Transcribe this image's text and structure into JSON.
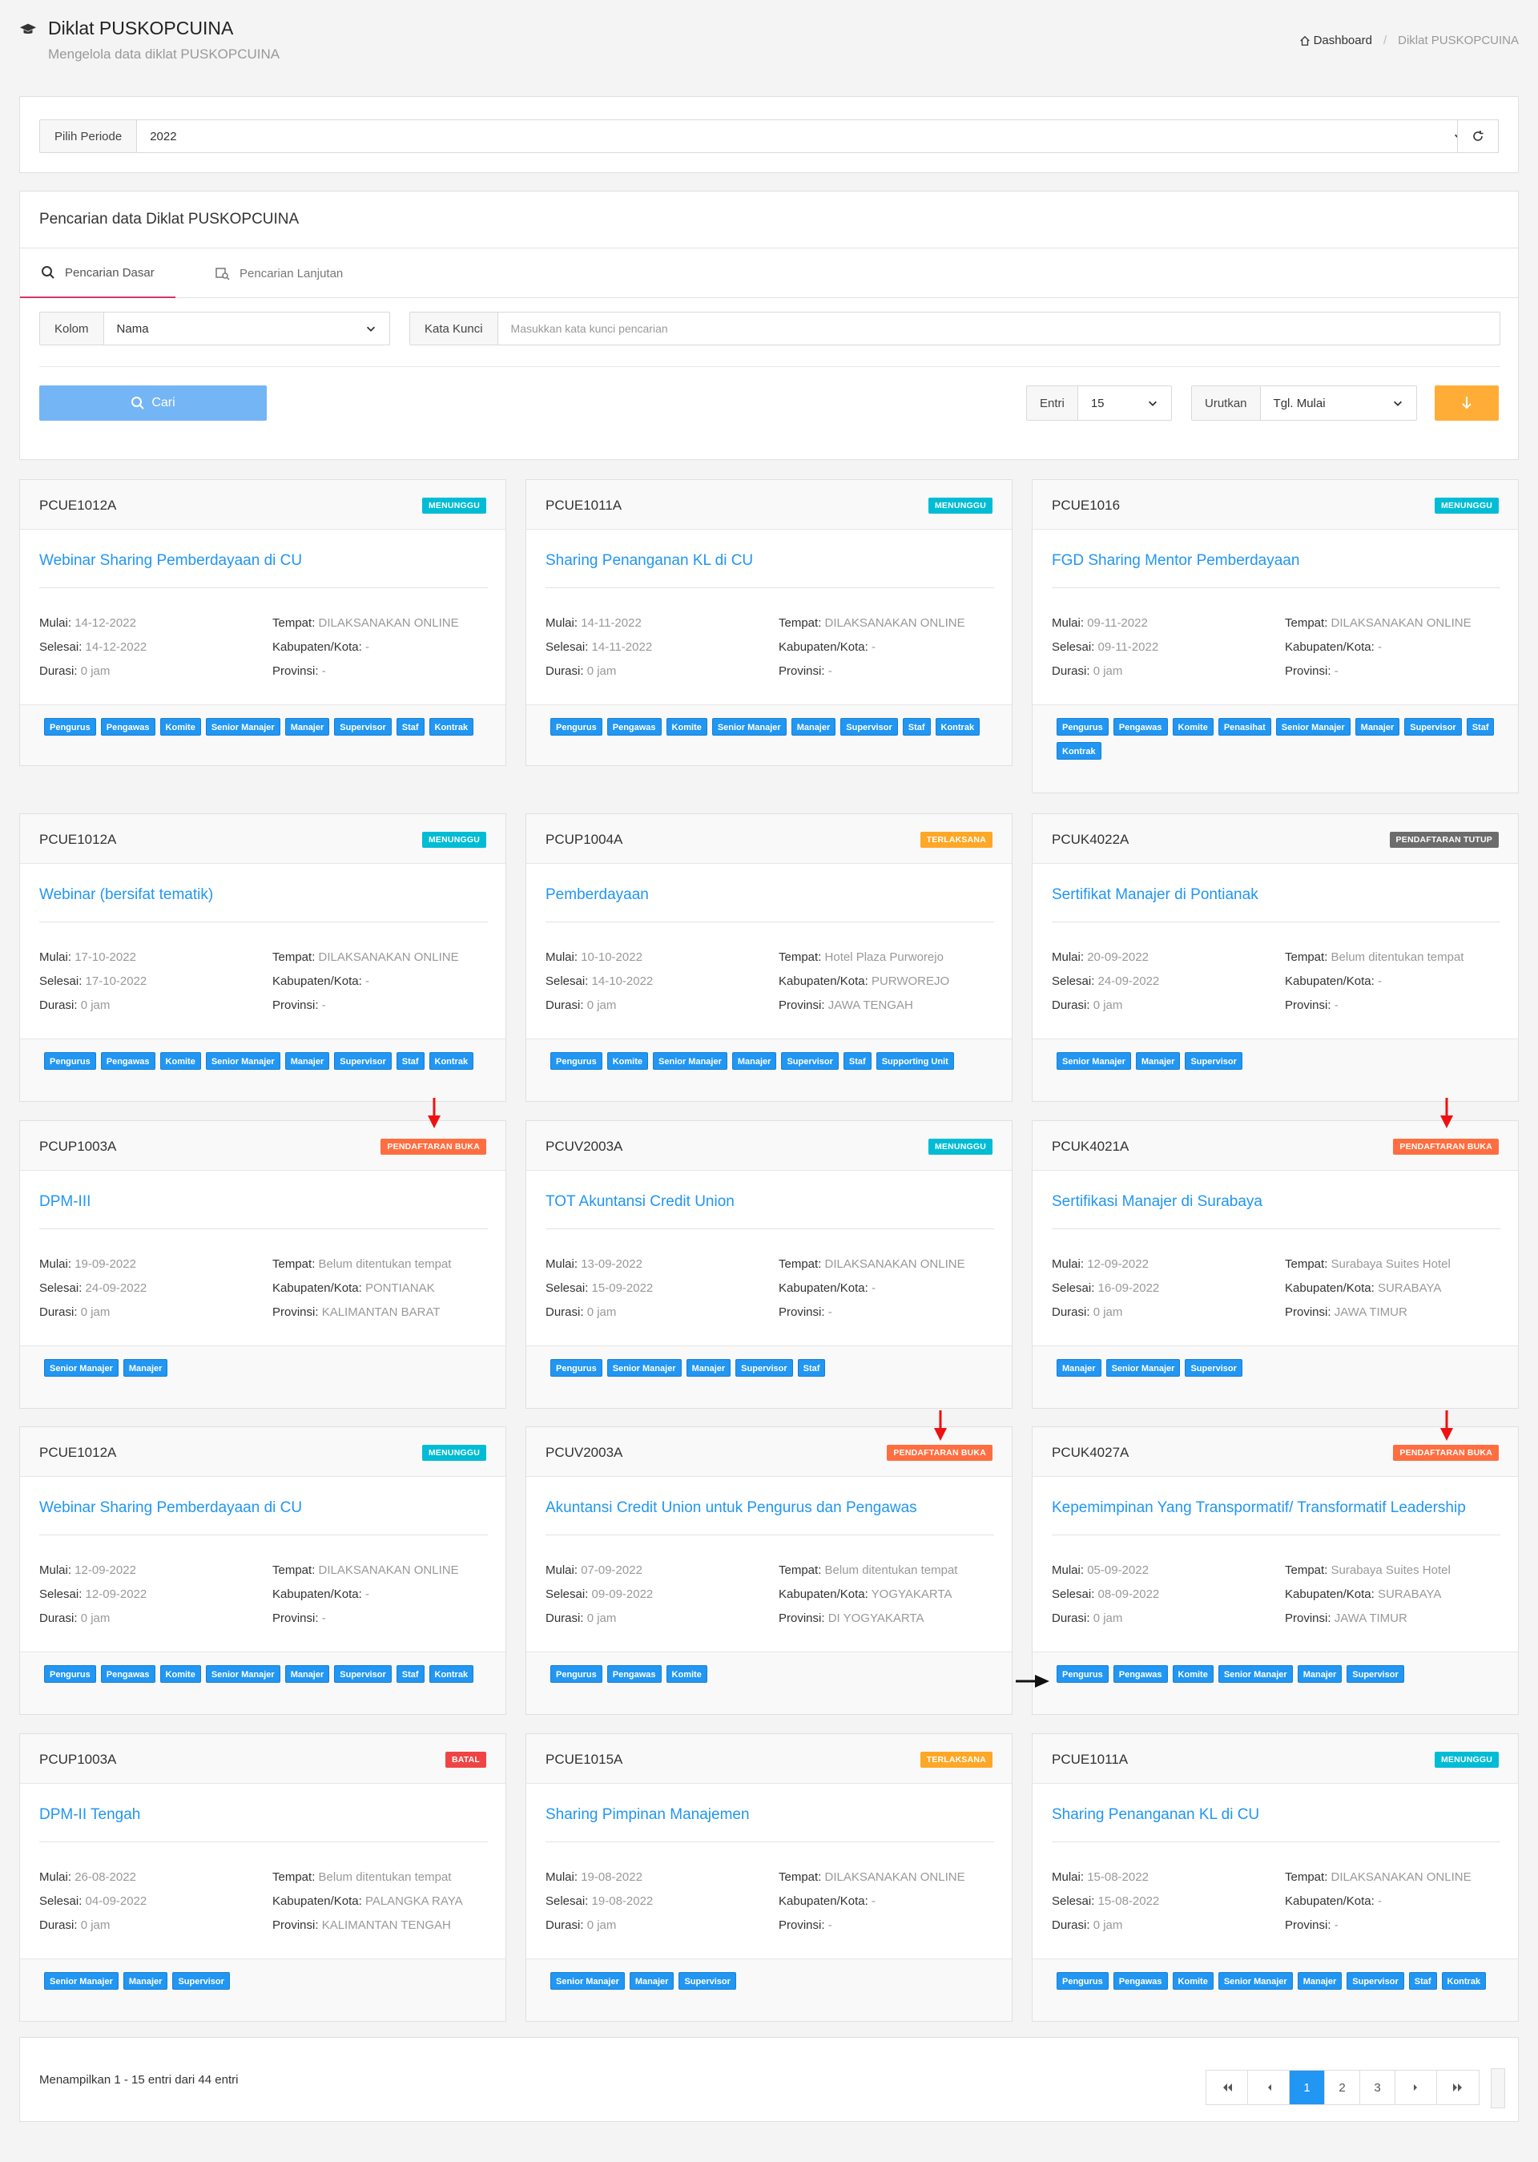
{
  "header": {
    "title": "Diklat PUSKOPCUINA",
    "subtitle": "Mengelola data diklat PUSKOPCUINA",
    "breadcrumb_home": "Dashboard",
    "breadcrumb_current": "Diklat PUSKOPCUINA"
  },
  "periode": {
    "label": "Pilih Periode",
    "value": "2022"
  },
  "search": {
    "title": "Pencarian data Diklat PUSKOPCUINA",
    "tab_basic": "Pencarian Dasar",
    "tab_advanced": "Pencarian Lanjutan",
    "kolom_label": "Kolom",
    "kolom_value": "Nama",
    "kata_kunci_label": "Kata Kunci",
    "kata_kunci_placeholder": "Masukkan kata kunci pencarian",
    "cari_label": "Cari",
    "entri_label": "Entri",
    "entri_value": "15",
    "urutkan_label": "Urutkan",
    "urutkan_value": "Tgl. Mulai"
  },
  "labels": {
    "mulai": "Mulai:",
    "selesai": "Selesai:",
    "durasi": "Durasi:",
    "tempat": "Tempat:",
    "kabupaten": "Kabupaten/Kota:",
    "provinsi": "Provinsi:"
  },
  "colors": {
    "menunggu": "#00bcd4",
    "terlaksana": "#ffa726",
    "pendaftaran_tutup": "#6c6c6c",
    "pendaftaran_buka": "#ff6e40",
    "batal": "#ef4444",
    "accent": "#2196f3"
  },
  "cards": [
    {
      "code": "PCUE1012A",
      "status": "MENUNGGU",
      "title": "Webinar Sharing Pemberdayaan di CU",
      "mulai": "14-12-2022",
      "selesai": "14-12-2022",
      "durasi": "0 jam",
      "tempat": "DILAKSANAKAN ONLINE",
      "kabupaten": "-",
      "provinsi": "-",
      "tags": [
        "Pengurus",
        "Pengawas",
        "Komite",
        "Senior Manajer",
        "Manajer",
        "Supervisor",
        "Staf",
        "Kontrak"
      ]
    },
    {
      "code": "PCUE1011A",
      "status": "MENUNGGU",
      "title": "Sharing Penanganan KL di CU",
      "mulai": "14-11-2022",
      "selesai": "14-11-2022",
      "durasi": "0 jam",
      "tempat": "DILAKSANAKAN ONLINE",
      "kabupaten": "-",
      "provinsi": "-",
      "tags": [
        "Pengurus",
        "Pengawas",
        "Komite",
        "Senior Manajer",
        "Manajer",
        "Supervisor",
        "Staf",
        "Kontrak"
      ]
    },
    {
      "code": "PCUE1016",
      "status": "MENUNGGU",
      "title": "FGD Sharing Mentor Pemberdayaan",
      "mulai": "09-11-2022",
      "selesai": "09-11-2022",
      "durasi": "0 jam",
      "tempat": "DILAKSANAKAN ONLINE",
      "kabupaten": "-",
      "provinsi": "-",
      "tags": [
        "Pengurus",
        "Pengawas",
        "Komite",
        "Penasihat",
        "Senior Manajer",
        "Manajer",
        "Supervisor",
        "Staf",
        "Kontrak"
      ]
    },
    {
      "code": "PCUE1012A",
      "status": "MENUNGGU",
      "title": "Webinar (bersifat tematik)",
      "mulai": "17-10-2022",
      "selesai": "17-10-2022",
      "durasi": "0 jam",
      "tempat": "DILAKSANAKAN ONLINE",
      "kabupaten": "-",
      "provinsi": "-",
      "tags": [
        "Pengurus",
        "Pengawas",
        "Komite",
        "Senior Manajer",
        "Manajer",
        "Supervisor",
        "Staf",
        "Kontrak"
      ]
    },
    {
      "code": "PCUP1004A",
      "status": "TERLAKSANA",
      "title": "Pemberdayaan",
      "mulai": "10-10-2022",
      "selesai": "14-10-2022",
      "durasi": "0 jam",
      "tempat": "Hotel Plaza Purworejo",
      "kabupaten": "PURWOREJO",
      "provinsi": "JAWA TENGAH",
      "tags": [
        "Pengurus",
        "Komite",
        "Senior Manajer",
        "Manajer",
        "Supervisor",
        "Staf",
        "Supporting Unit"
      ]
    },
    {
      "code": "PCUK4022A",
      "status": "PENDAFTARAN TUTUP",
      "title": "Sertifikat Manajer di Pontianak",
      "mulai": "20-09-2022",
      "selesai": "24-09-2022",
      "durasi": "0 jam",
      "tempat": "Belum ditentukan tempat",
      "kabupaten": "-",
      "provinsi": "-",
      "tags": [
        "Senior Manajer",
        "Manajer",
        "Supervisor"
      ]
    },
    {
      "code": "PCUP1003A",
      "status": "PENDAFTARAN BUKA",
      "title": "DPM-III",
      "mulai": "19-09-2022",
      "selesai": "24-09-2022",
      "durasi": "0 jam",
      "tempat": "Belum ditentukan tempat",
      "kabupaten": "PONTIANAK",
      "provinsi": "KALIMANTAN BARAT",
      "tags": [
        "Senior Manajer",
        "Manajer"
      ]
    },
    {
      "code": "PCUV2003A",
      "status": "MENUNGGU",
      "title": "TOT Akuntansi Credit Union",
      "mulai": "13-09-2022",
      "selesai": "15-09-2022",
      "durasi": "0 jam",
      "tempat": "DILAKSANAKAN ONLINE",
      "kabupaten": "-",
      "provinsi": "-",
      "tags": [
        "Pengurus",
        "Senior Manajer",
        "Manajer",
        "Supervisor",
        "Staf"
      ]
    },
    {
      "code": "PCUK4021A",
      "status": "PENDAFTARAN BUKA",
      "title": "Sertifikasi Manajer di Surabaya",
      "mulai": "12-09-2022",
      "selesai": "16-09-2022",
      "durasi": "0 jam",
      "tempat": "Surabaya Suites Hotel",
      "kabupaten": "SURABAYA",
      "provinsi": "JAWA TIMUR",
      "tags": [
        "Manajer",
        "Senior Manajer",
        "Supervisor"
      ]
    },
    {
      "code": "PCUE1012A",
      "status": "MENUNGGU",
      "title": "Webinar Sharing Pemberdayaan di CU",
      "mulai": "12-09-2022",
      "selesai": "12-09-2022",
      "durasi": "0 jam",
      "tempat": "DILAKSANAKAN ONLINE",
      "kabupaten": "-",
      "provinsi": "-",
      "tags": [
        "Pengurus",
        "Pengawas",
        "Komite",
        "Senior Manajer",
        "Manajer",
        "Supervisor",
        "Staf",
        "Kontrak"
      ]
    },
    {
      "code": "PCUV2003A",
      "status": "PENDAFTARAN BUKA",
      "title": "Akuntansi Credit Union untuk Pengurus dan Pengawas",
      "mulai": "07-09-2022",
      "selesai": "09-09-2022",
      "durasi": "0 jam",
      "tempat": "Belum ditentukan tempat",
      "kabupaten": "YOGYAKARTA",
      "provinsi": "DI YOGYAKARTA",
      "tags": [
        "Pengurus",
        "Pengawas",
        "Komite"
      ]
    },
    {
      "code": "PCUK4027A",
      "status": "PENDAFTARAN BUKA",
      "title": "Kepemimpinan Yang Transpormatif/ Transformatif Leadership",
      "mulai": "05-09-2022",
      "selesai": "08-09-2022",
      "durasi": "0 jam",
      "tempat": "Surabaya Suites Hotel",
      "kabupaten": "SURABAYA",
      "provinsi": "JAWA TIMUR",
      "tags": [
        "Pengurus",
        "Pengawas",
        "Komite",
        "Senior Manajer",
        "Manajer",
        "Supervisor"
      ]
    },
    {
      "code": "PCUP1003A",
      "status": "BATAL",
      "title": "DPM-II Tengah",
      "mulai": "26-08-2022",
      "selesai": "04-09-2022",
      "durasi": "0 jam",
      "tempat": "Belum ditentukan tempat",
      "kabupaten": "PALANGKA RAYA",
      "provinsi": "KALIMANTAN TENGAH",
      "tags": [
        "Senior Manajer",
        "Manajer",
        "Supervisor"
      ]
    },
    {
      "code": "PCUE1015A",
      "status": "TERLAKSANA",
      "title": "Sharing Pimpinan Manajemen",
      "mulai": "19-08-2022",
      "selesai": "19-08-2022",
      "durasi": "0 jam",
      "tempat": "DILAKSANAKAN ONLINE",
      "kabupaten": "-",
      "provinsi": "-",
      "tags": [
        "Senior Manajer",
        "Manajer",
        "Supervisor"
      ]
    },
    {
      "code": "PCUE1011A",
      "status": "MENUNGGU",
      "title": "Sharing Penanganan KL di CU",
      "mulai": "15-08-2022",
      "selesai": "15-08-2022",
      "durasi": "0 jam",
      "tempat": "DILAKSANAKAN ONLINE",
      "kabupaten": "-",
      "provinsi": "-",
      "tags": [
        "Pengurus",
        "Pengawas",
        "Komite",
        "Senior Manajer",
        "Manajer",
        "Supervisor",
        "Staf",
        "Kontrak"
      ]
    }
  ],
  "pagination": {
    "info": "Menampilkan 1 - 15 entri dari 44 entri",
    "pages": [
      "1",
      "2",
      "3"
    ],
    "current": "1"
  }
}
